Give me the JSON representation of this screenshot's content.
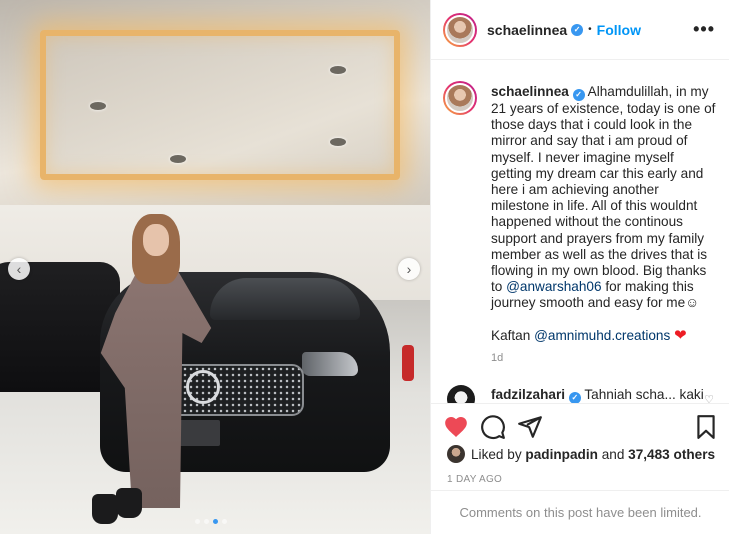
{
  "post": {
    "carousel": {
      "slide_count": 4,
      "active_index": 2
    }
  },
  "header": {
    "username": "schaelinnea",
    "verified_icon": "verified-badge-icon",
    "separator": "•",
    "follow_label": "Follow",
    "more_icon": "more-options-icon",
    "more_label": "•••"
  },
  "caption": {
    "username": "schaelinnea",
    "text_before_mention": "Alhamdulillah, in my 21 years of existence, today is one of those days that i could look in the mirror and say that i am proud of myself. I never imagine myself getting my dream car this early and here i am achieving another milestone in life. All of this wouldnt happened without the continous support and prayers from my family member as well as the drives that is flowing in my own blood. Big thanks to ",
    "mention_1": "@anwarshah06",
    "text_after_mention": " for making this journey smooth and easy for me",
    "emoji_1": "☺",
    "kaftan_label": "Kaftan ",
    "mention_2": "@amnimuhd.creations",
    "emoji_2": "❤",
    "age": "1d"
  },
  "comment": {
    "username": "fadzilzahari",
    "text": "Tahniah scha... kaki",
    "heart_label": "♡"
  },
  "actions": {
    "like_icon": "heart-filled-icon",
    "comment_icon": "comment-icon",
    "share_icon": "share-icon",
    "save_icon": "bookmark-icon",
    "like_color": "#ed4956"
  },
  "likes": {
    "prefix": "Liked by ",
    "user": "padinpadin",
    "middle": " and ",
    "count": "37,483 others"
  },
  "timestamp": "1 DAY AGO",
  "comments_limited": "Comments on this post have been limited.",
  "colors": {
    "link_blue": "#0095f6",
    "mention": "#00376b",
    "muted": "#8e8e8e",
    "text": "#262626"
  }
}
